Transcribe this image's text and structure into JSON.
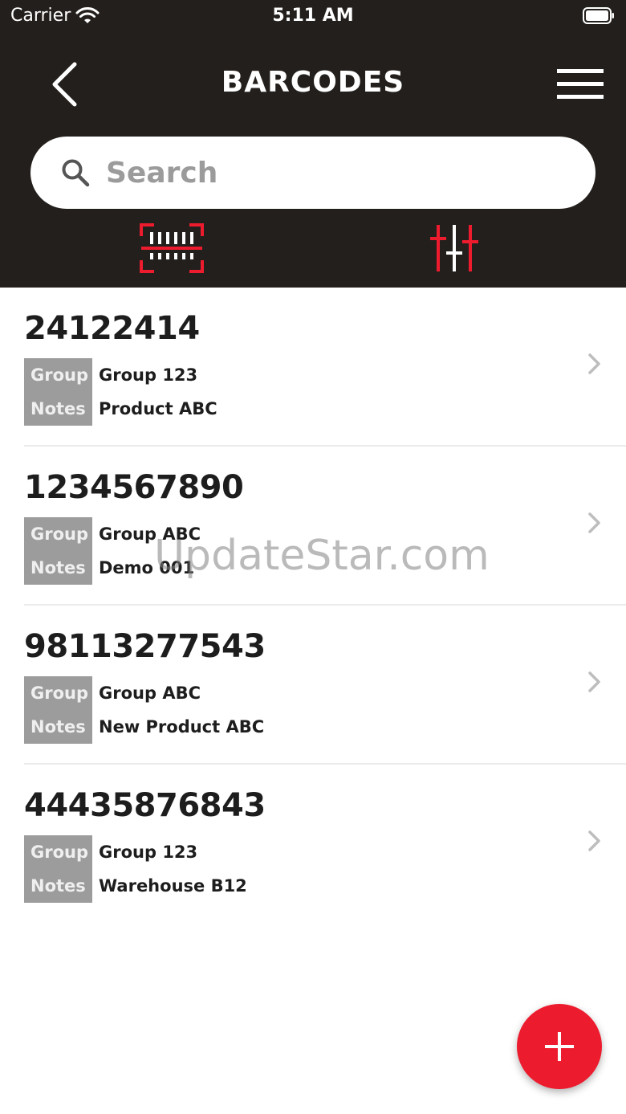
{
  "status_bar": {
    "carrier": "Carrier",
    "time": "5:11 AM"
  },
  "nav": {
    "title": "BARCODES"
  },
  "search": {
    "placeholder": "Search"
  },
  "barcodes": [
    {
      "code": "24122414",
      "group_label": "Group",
      "group": "Group 123",
      "notes_label": "Notes",
      "notes": "Product ABC"
    },
    {
      "code": "1234567890",
      "group_label": "Group",
      "group": "Group ABC",
      "notes_label": "Notes",
      "notes": "Demo 001"
    },
    {
      "code": "98113277543",
      "group_label": "Group",
      "group": "Group ABC",
      "notes_label": "Notes",
      "notes": "New Product ABC"
    },
    {
      "code": "44435876843",
      "group_label": "Group",
      "group": "Group 123",
      "notes_label": "Notes",
      "notes": "Warehouse B12"
    }
  ],
  "watermark": "UpdateStar.com",
  "colors": {
    "header_bg": "#231f1c",
    "accent": "#ed1b2e",
    "tag_bg": "#9c9c9c"
  },
  "icons": [
    "back-chevron-icon",
    "hamburger-menu-icon",
    "search-icon",
    "barcode-scan-icon",
    "filter-sliders-icon",
    "chevron-right-icon",
    "plus-icon"
  ]
}
